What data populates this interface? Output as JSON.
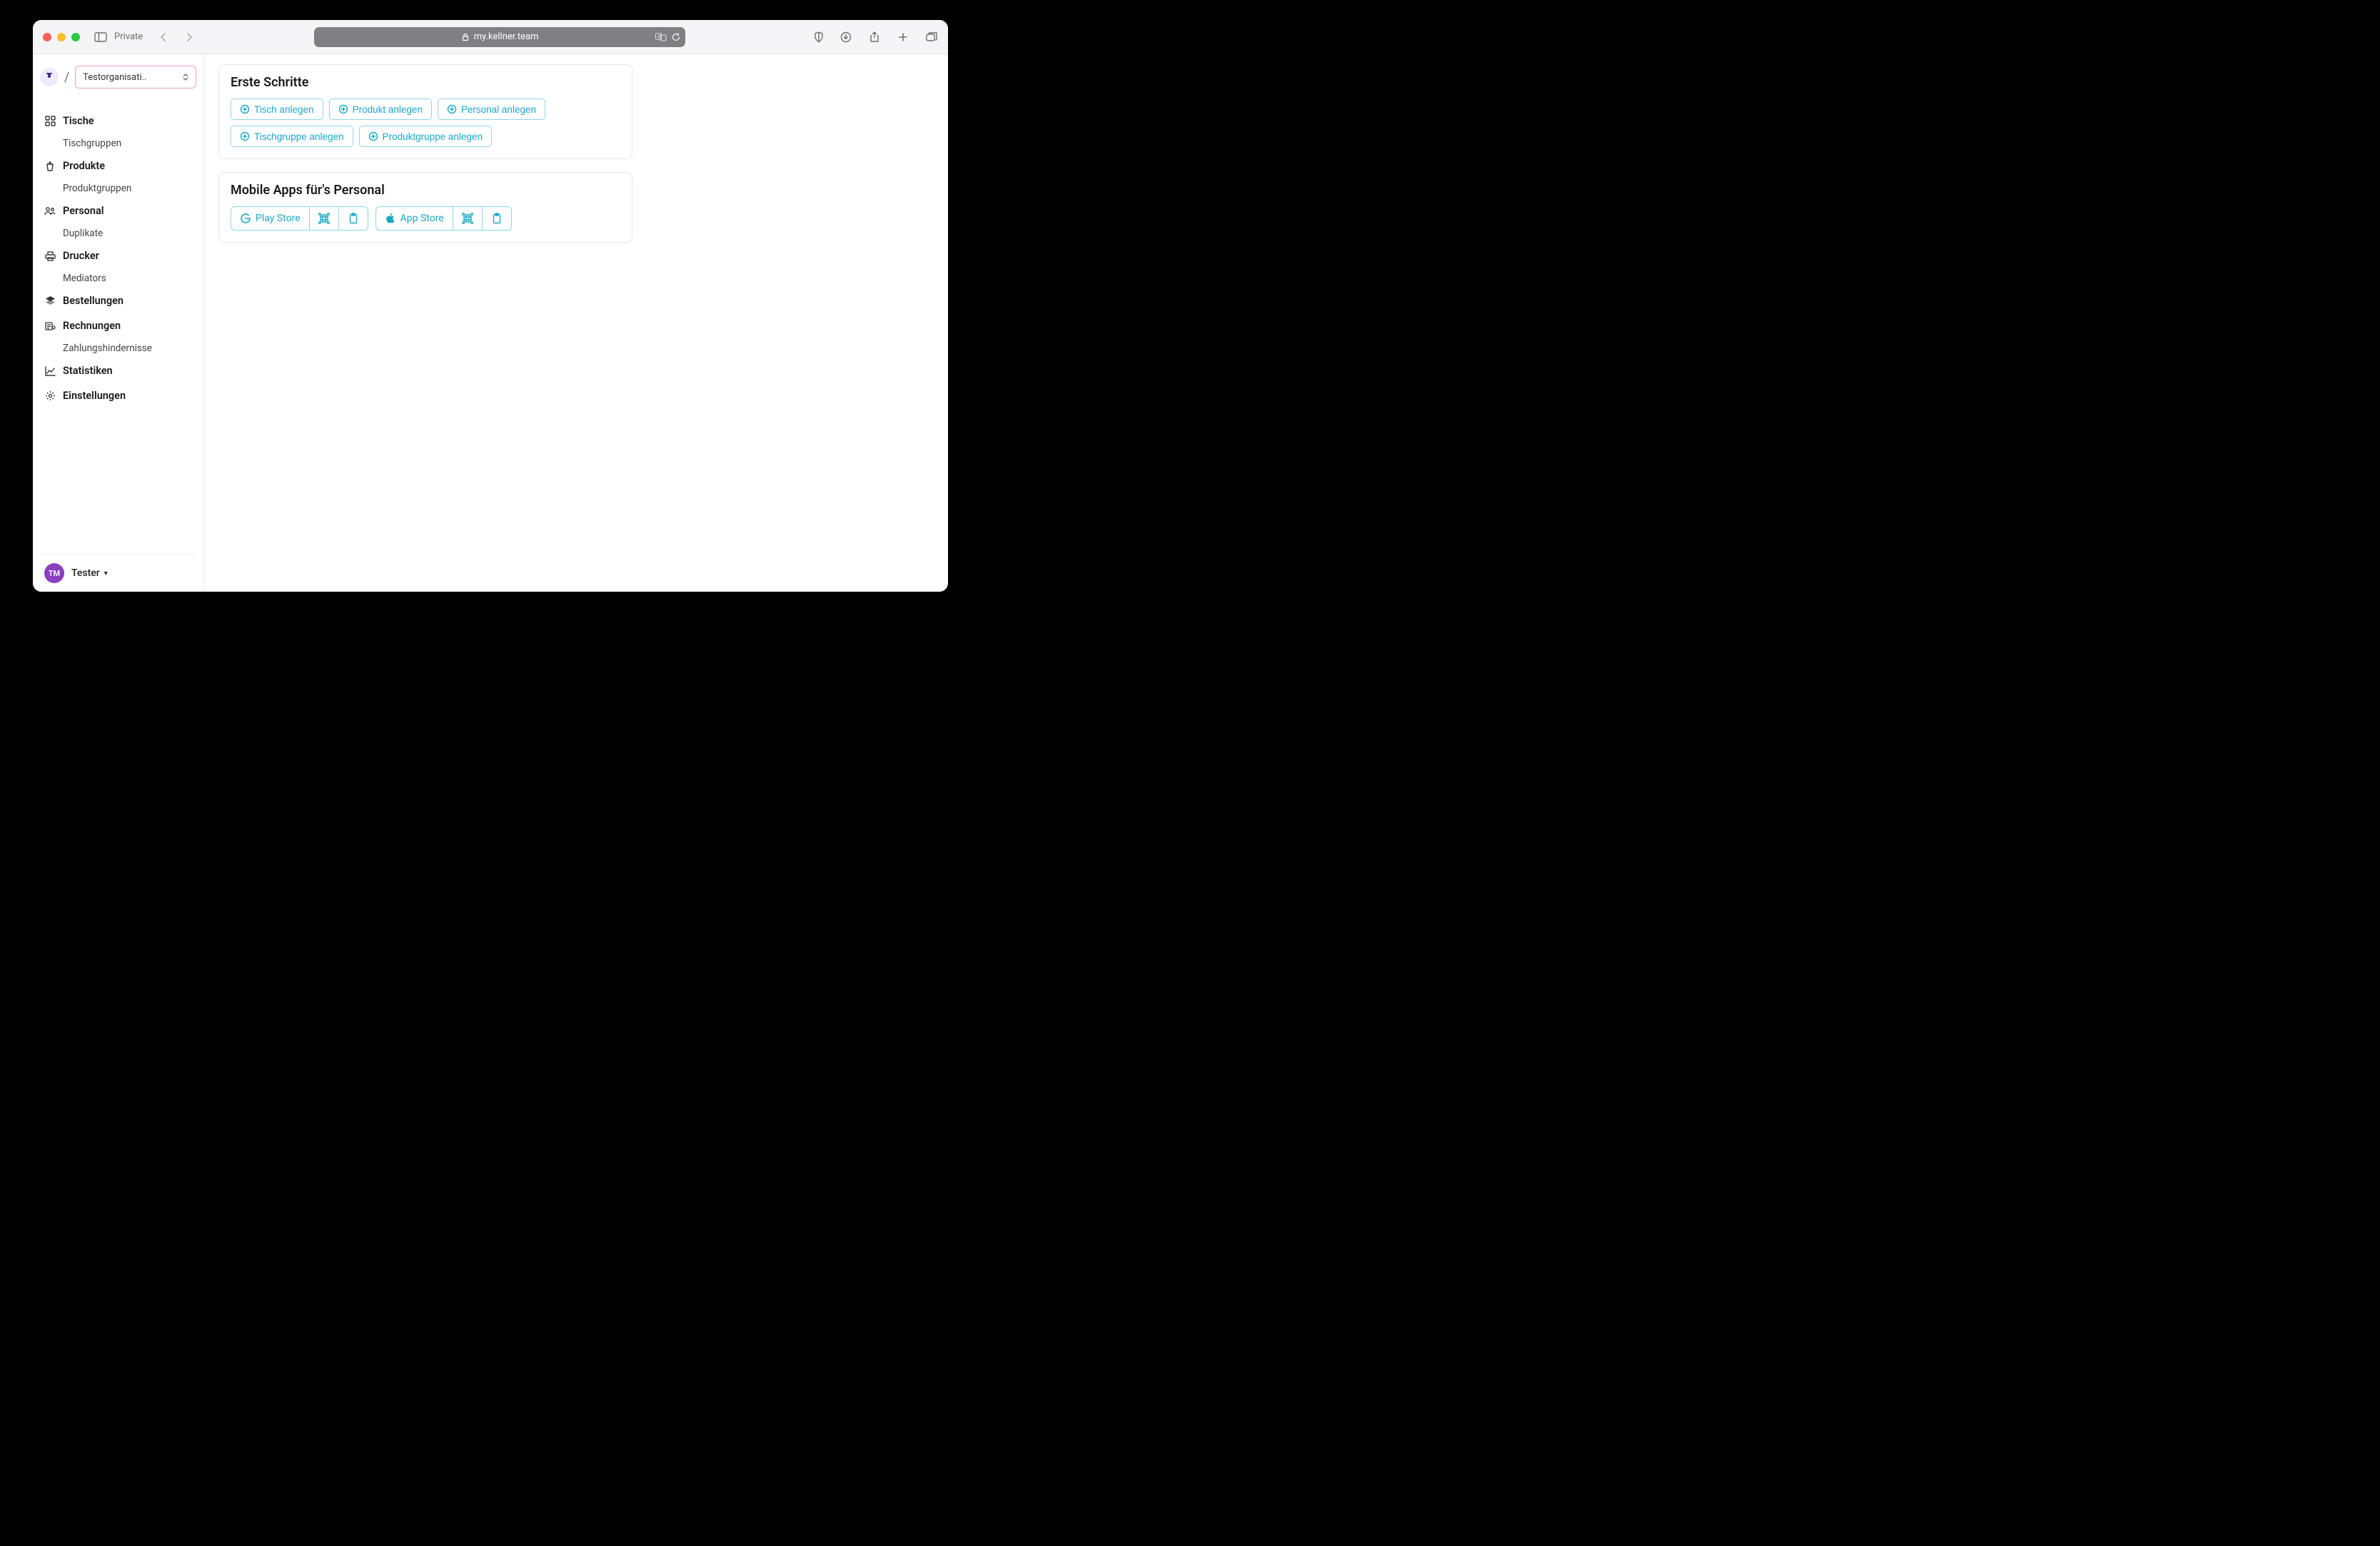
{
  "browser": {
    "private_label": "Private",
    "url": "my.kellner.team"
  },
  "sidebar": {
    "org_selected": "Testorganisati..",
    "items": [
      {
        "label": "Tische",
        "sub": "Tischgruppen"
      },
      {
        "label": "Produkte",
        "sub": "Produktgruppen"
      },
      {
        "label": "Personal",
        "sub": "Duplikate"
      },
      {
        "label": "Drucker",
        "sub": "Mediators"
      },
      {
        "label": "Bestellungen"
      },
      {
        "label": "Rechnungen",
        "sub": "Zahlungshindernisse"
      },
      {
        "label": "Statistiken"
      },
      {
        "label": "Einstellungen"
      }
    ],
    "user": {
      "initials": "TM",
      "name": "Tester"
    }
  },
  "main": {
    "first_steps": {
      "title": "Erste Schritte",
      "actions": [
        "Tisch anlegen",
        "Produkt anlegen",
        "Personal anlegen",
        "Tischgruppe anlegen",
        "Produktgruppe anlegen"
      ]
    },
    "apps": {
      "title": "Mobile Apps für's Personal",
      "stores": {
        "play": "Play Store",
        "appstore": "App Store"
      }
    }
  },
  "footer": {
    "brand_part": "kellner"
  },
  "colors": {
    "accent": "#1aa7c6",
    "accent_border": "#8fd6e6",
    "org_select_border": "#e9a4b8",
    "avatar_bg": "#8a3fbf"
  }
}
